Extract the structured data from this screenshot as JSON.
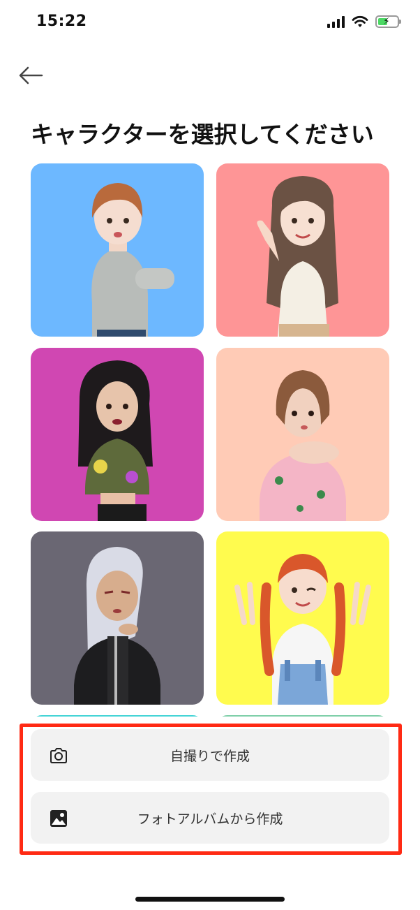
{
  "status_bar": {
    "time": "15:22",
    "signal_icon": "cellular-signal-icon",
    "wifi_icon": "wifi-icon",
    "battery_icon": "battery-charging-icon",
    "battery_color": "#4cd964"
  },
  "header": {
    "back_icon": "arrow-left-icon"
  },
  "page": {
    "title": "キャラクターを選択してください"
  },
  "characters": [
    {
      "id": "character-1",
      "background": "#6db8ff",
      "description_icon": "avatar-short-brown-hair-grey-sweater"
    },
    {
      "id": "character-2",
      "background": "#fe9596",
      "description_icon": "avatar-long-hair-waving"
    },
    {
      "id": "character-3",
      "background": "#d047b2",
      "description_icon": "avatar-curly-black-hair"
    },
    {
      "id": "character-4",
      "background": "#ffcbb6",
      "description_icon": "avatar-bob-hair-pink-pajama"
    },
    {
      "id": "character-5",
      "background": "#6a6773",
      "description_icon": "avatar-silver-hair-black-jacket"
    },
    {
      "id": "character-6",
      "background": "#fffb4e",
      "description_icon": "avatar-red-braids-overalls"
    },
    {
      "id": "character-7",
      "background": "#45d4d6",
      "description_icon": "avatar-partial"
    },
    {
      "id": "character-8",
      "background": "#7fcfa9",
      "description_icon": "avatar-partial"
    }
  ],
  "actions": {
    "selfie_label": "自撮りで作成",
    "selfie_icon": "camera-icon",
    "album_label": "フォトアルバムから作成",
    "album_icon": "photo-album-icon",
    "highlight_color": "#ff2a14"
  }
}
